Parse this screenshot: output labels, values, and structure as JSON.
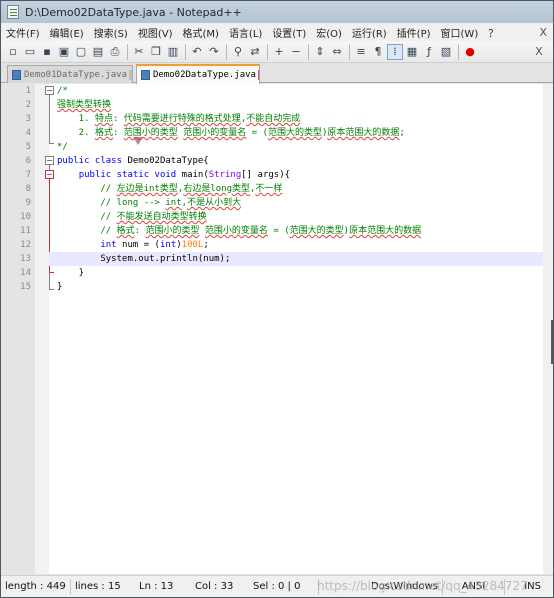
{
  "window": {
    "title": "D:\\Demo02DataType.java - Notepad++"
  },
  "menu": {
    "items": [
      "文件(F)",
      "编辑(E)",
      "搜索(S)",
      "视图(V)",
      "格式(M)",
      "语言(L)",
      "设置(T)",
      "宏(O)",
      "运行(R)",
      "插件(P)",
      "窗口(W)",
      "？"
    ],
    "close": "X"
  },
  "toolbar": {
    "icons": [
      "new-file-icon",
      "open-file-icon",
      "save-icon",
      "save-all-icon",
      "close-file-icon",
      "close-all-icon",
      "print-icon",
      "cut-icon",
      "copy-icon",
      "paste-icon",
      "undo-icon",
      "redo-icon",
      "find-icon",
      "replace-icon",
      "zoom-in-icon",
      "zoom-out-icon",
      "sync-scroll-vertical-icon",
      "sync-scroll-horizontal-icon",
      "word-wrap-icon",
      "show-all-chars-icon",
      "indent-guide-icon",
      "doc-map-icon",
      "function-list-icon",
      "folder-as-workspace-icon",
      "record-macro-icon"
    ],
    "close": "X"
  },
  "tabs": [
    {
      "label": "Demo01DataType.java",
      "active": false
    },
    {
      "label": "Demo02DataType.java",
      "active": true
    }
  ],
  "editor": {
    "line_numbers": [
      "1",
      "2",
      "3",
      "4",
      "5",
      "6",
      "7",
      "8",
      "9",
      "10",
      "11",
      "12",
      "13",
      "14",
      "15"
    ],
    "current_line": 13
  },
  "status": {
    "length": "length : 449",
    "lines": "lines : 15",
    "ln": "Ln : 13",
    "col": "Col : 33",
    "sel": "Sel : 0 | 0",
    "eol": "Dos\\Windows",
    "encoding": "ANSI",
    "mode": "INS"
  },
  "watermark": "https://blog.csdn.net/qq_43284727"
}
